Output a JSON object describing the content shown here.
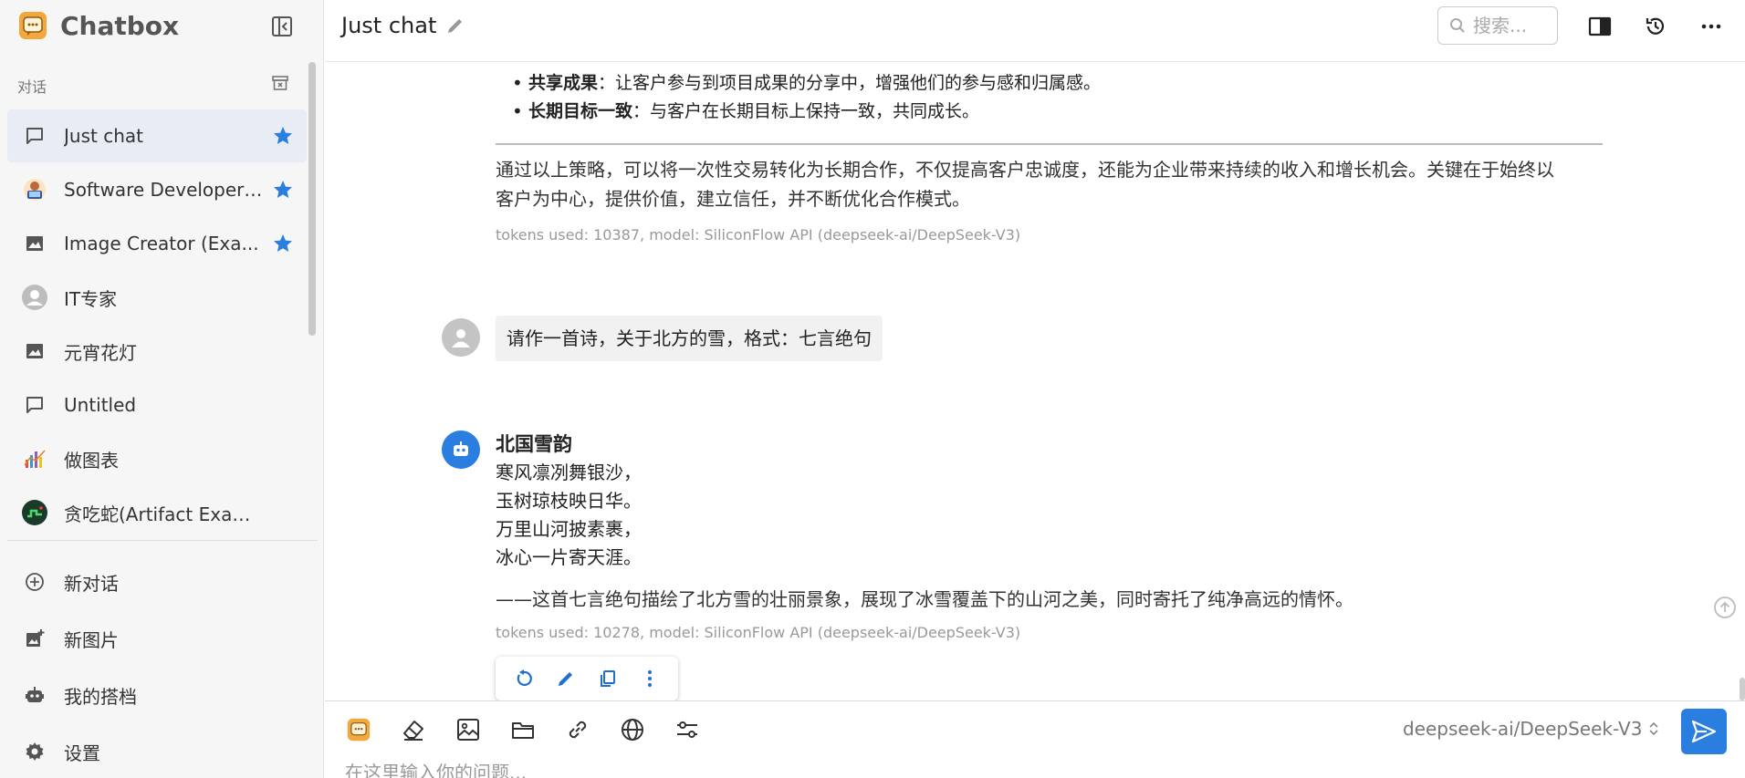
{
  "app": {
    "name": "Chatbox"
  },
  "sidebar": {
    "section_label": "对话",
    "items": [
      {
        "label": "Just chat",
        "icon": "chat-bubble-icon",
        "starred": true,
        "active": true
      },
      {
        "label": "Software Developer ...",
        "icon": "developer-avatar-icon",
        "starred": true,
        "active": false
      },
      {
        "label": "Image Creator (Exa...",
        "icon": "image-icon",
        "starred": true,
        "active": false
      },
      {
        "label": "IT专家",
        "icon": "person-avatar-icon",
        "starred": false,
        "active": false
      },
      {
        "label": "元宵花灯",
        "icon": "image-icon",
        "starred": false,
        "active": false
      },
      {
        "label": "Untitled",
        "icon": "chat-bubble-icon",
        "starred": false,
        "active": false
      },
      {
        "label": "做图表",
        "icon": "chart-avatar-icon",
        "starred": false,
        "active": false
      },
      {
        "label": "贪吃蛇(Artifact Example)",
        "icon": "snake-game-avatar-icon",
        "starred": false,
        "active": false
      }
    ],
    "actions": [
      {
        "label": "新对话",
        "icon": "plus-circle-icon"
      },
      {
        "label": "新图片",
        "icon": "add-image-icon"
      },
      {
        "label": "我的搭档",
        "icon": "robot-icon"
      },
      {
        "label": "设置",
        "icon": "gear-icon"
      }
    ]
  },
  "header": {
    "title": "Just chat",
    "search_placeholder": "搜索..."
  },
  "messages": {
    "bullets": [
      {
        "bold": "共享成果",
        "text": "：让客户参与到项目成果的分享中，增强他们的参与感和归属感。"
      },
      {
        "bold": "长期目标一致",
        "text": "：与客户在长期目标上保持一致，共同成长。"
      }
    ],
    "summary_line1": "通过以上策略，可以将一次性交易转化为长期合作，不仅提高客户忠诚度，还能为企业带来持续的收入和增长机会。关键在于始终以",
    "summary_line2": "客户为中心，提供价值，建立信任，并不断优化合作模式。",
    "meta1": "tokens used: 10387, model: SiliconFlow API (deepseek-ai/DeepSeek-V3)",
    "user_message": "请作一首诗，关于北方的雪，格式：七言绝句",
    "poem": {
      "title": "北国雪韵",
      "lines": [
        "寒风凛冽舞银沙，",
        "玉树琼枝映日华。",
        "万里山河披素裹，",
        "冰心一片寄天涯。"
      ]
    },
    "comment": "——这首七言绝句描绘了北方雪的壮丽景象，展现了冰雪覆盖下的山河之美，同时寄托了纯净高远的情怀。",
    "meta2": "tokens used: 10278, model: SiliconFlow API (deepseek-ai/DeepSeek-V3)"
  },
  "input": {
    "model": "deepseek-ai/DeepSeek-V3",
    "placeholder": "在这里输入你的问题..."
  },
  "colors": {
    "accent": "#2a7ee0",
    "star": "#2a7ee0",
    "active_bg": "#e8edf5"
  }
}
